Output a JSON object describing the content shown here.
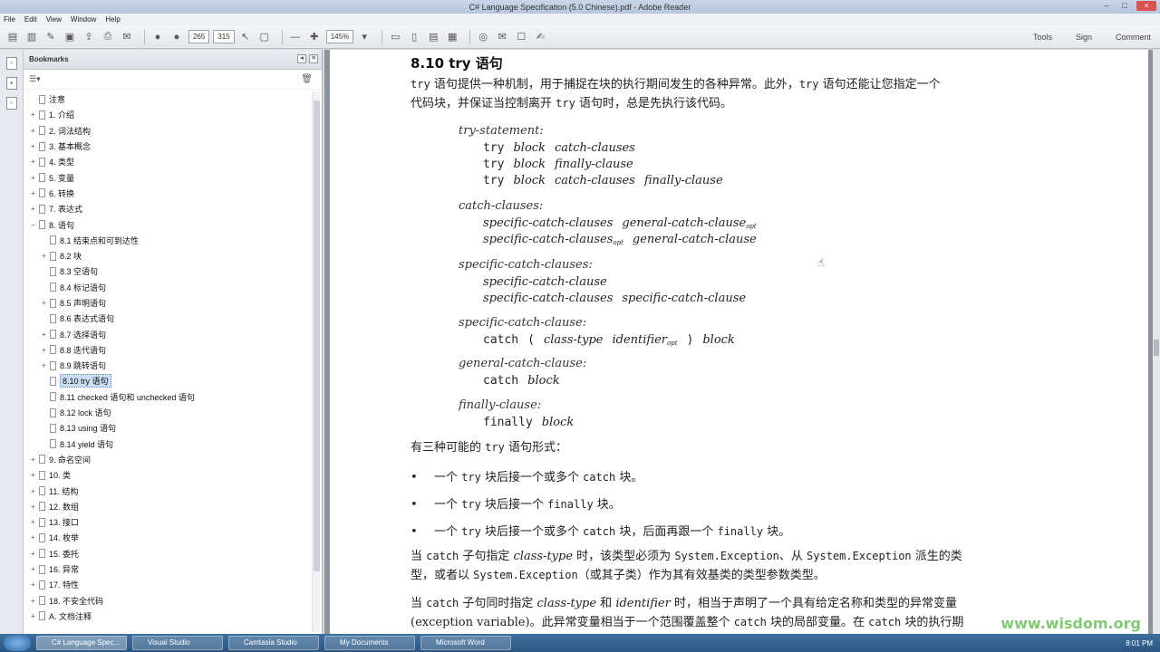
{
  "window": {
    "title": "C# Language Specification (5.0 Chinese).pdf - Adobe Reader",
    "buttons": [
      "–",
      "□",
      "×"
    ]
  },
  "menu": [
    "File",
    "Edit",
    "View",
    "Window",
    "Help"
  ],
  "toolbar": {
    "page_current": "265",
    "page_total": "315",
    "zoom": "145%",
    "right": [
      "Tools",
      "Sign",
      "Comment"
    ]
  },
  "bookmarks": {
    "title": "Bookmarks",
    "items": [
      {
        "label": "注意",
        "toggle": ""
      },
      {
        "label": "1. 介绍",
        "toggle": "+"
      },
      {
        "label": "2. 词法结构",
        "toggle": "+"
      },
      {
        "label": "3. 基本概念",
        "toggle": "+"
      },
      {
        "label": "4. 类型",
        "toggle": "+"
      },
      {
        "label": "5. 变量",
        "toggle": "+"
      },
      {
        "label": "6. 转换",
        "toggle": "+"
      },
      {
        "label": "7. 表达式",
        "toggle": "+"
      },
      {
        "label": "8. 语句",
        "toggle": "−"
      },
      {
        "label": "8.1 结束点和可到达性",
        "toggle": ""
      },
      {
        "label": "8.2 块",
        "toggle": "+"
      },
      {
        "label": "8.3 空语句",
        "toggle": ""
      },
      {
        "label": "8.4 标记语句",
        "toggle": ""
      },
      {
        "label": "8.5 声明语句",
        "toggle": "+"
      },
      {
        "label": "8.6 表达式语句",
        "toggle": ""
      },
      {
        "label": "8.7 选择语句",
        "toggle": "+"
      },
      {
        "label": "8.8 迭代语句",
        "toggle": "+"
      },
      {
        "label": "8.9 跳转语句",
        "toggle": "+"
      },
      {
        "label": "8.10 try 语句",
        "toggle": ""
      },
      {
        "label": "8.11 checked 语句和 unchecked 语句",
        "toggle": ""
      },
      {
        "label": "8.12 lock 语句",
        "toggle": ""
      },
      {
        "label": "8.13 using 语句",
        "toggle": ""
      },
      {
        "label": "8.14 yield 语句",
        "toggle": ""
      },
      {
        "label": "9. 命名空间",
        "toggle": "+"
      },
      {
        "label": "10. 类",
        "toggle": "+"
      },
      {
        "label": "11. 结构",
        "toggle": "+"
      },
      {
        "label": "12. 数组",
        "toggle": "+"
      },
      {
        "label": "13. 接口",
        "toggle": "+"
      },
      {
        "label": "14. 枚举",
        "toggle": "+"
      },
      {
        "label": "15. 委托",
        "toggle": "+"
      },
      {
        "label": "16. 异常",
        "toggle": "+"
      },
      {
        "label": "17. 特性",
        "toggle": "+"
      },
      {
        "label": "18. 不安全代码",
        "toggle": "+"
      },
      {
        "label": "A. 文档注释",
        "toggle": "+"
      }
    ]
  },
  "document": {
    "heading": "8.10 try 语句",
    "intro_1a": "try",
    "intro_1b": " 语句提供一种机制，用于捕捉在块的执行期间发生的各种异常。此外，",
    "intro_1c": "try",
    "intro_1d": " 语句还能让您指定一个",
    "intro_2a": "代码块，并保证当控制离开 ",
    "intro_2b": "try",
    "intro_2c": " 语句时，总是先执行该代码。",
    "grammar": {
      "try_statement": "try-statement:",
      "try_kw": "try",
      "block": "block",
      "catch_clauses": "catch-clauses",
      "finally_clause": "finally-clause",
      "catch_clauses_head": "catch-clauses:",
      "specific_catch_clauses": "specific-catch-clauses",
      "general_catch_clause": "general-catch-clause",
      "opt": "opt",
      "specific_catch_clauses_head": "specific-catch-clauses:",
      "specific_catch_clause": "specific-catch-clause",
      "specific_catch_clause_head": "specific-catch-clause:",
      "catch_kw": "catch",
      "lparen": "(",
      "class_type": "class-type",
      "identifier": "identifier",
      "rparen": ")",
      "general_catch_clause_head": "general-catch-clause:",
      "finally_clause_head": "finally-clause:",
      "finally_kw": "finally"
    },
    "forms_a": "有三种可能的 ",
    "forms_b": "try",
    "forms_c": " 语句形式：",
    "bullets": [
      {
        "a": "一个 ",
        "b": "try",
        "c": " 块后接一个或多个 ",
        "d": "catch",
        "e": " 块。",
        "f": "",
        "g": ""
      },
      {
        "a": "一个 ",
        "b": "try",
        "c": " 块后接一个 ",
        "d": "finally",
        "e": " 块。",
        "f": "",
        "g": ""
      },
      {
        "a": "一个 ",
        "b": "try",
        "c": " 块后接一个或多个 ",
        "d": "catch",
        "e": " 块，后面再跟一个 ",
        "f": "finally",
        "g": " 块。"
      }
    ],
    "p1_1a": "当 ",
    "p1_1b": "catch",
    "p1_1c": " 子句指定 ",
    "p1_1d": "class-type",
    "p1_1e": " 时，该类型必须为 ",
    "p1_1f": "System.Exception",
    "p1_1g": "、从 ",
    "p1_1h": "System.Exception",
    "p1_1i": " 派生的类",
    "p1_2a": "型，或者以 ",
    "p1_2b": "System.Exception",
    "p1_2c": "（或其子类）作为其有效基类的类型参数类型。",
    "p2_1a": "当 ",
    "p2_1b": "catch",
    "p2_1c": " 子句同时指定 ",
    "p2_1d": "class-type",
    "p2_1e": " 和 ",
    "p2_1f": "identifier",
    "p2_1g": " 时，相当于声明了一个具有给定名称和类型的异常变量",
    "p2_2a": "(exception variable)。此异常变量相当于一个范围覆盖整个 ",
    "p2_2b": "catch",
    "p2_2c": " 块的局部变量。在 ",
    "p2_2d": "catch",
    "p2_2e": " 块的执行期",
    "watermark": "www.wisdom.org"
  },
  "taskbar": {
    "tasks": [
      "C# Language Spec...",
      "Visual Studio",
      "Camtasia Studio",
      "My Documents",
      "Microsoft Word"
    ],
    "clock": "8:01 PM"
  }
}
